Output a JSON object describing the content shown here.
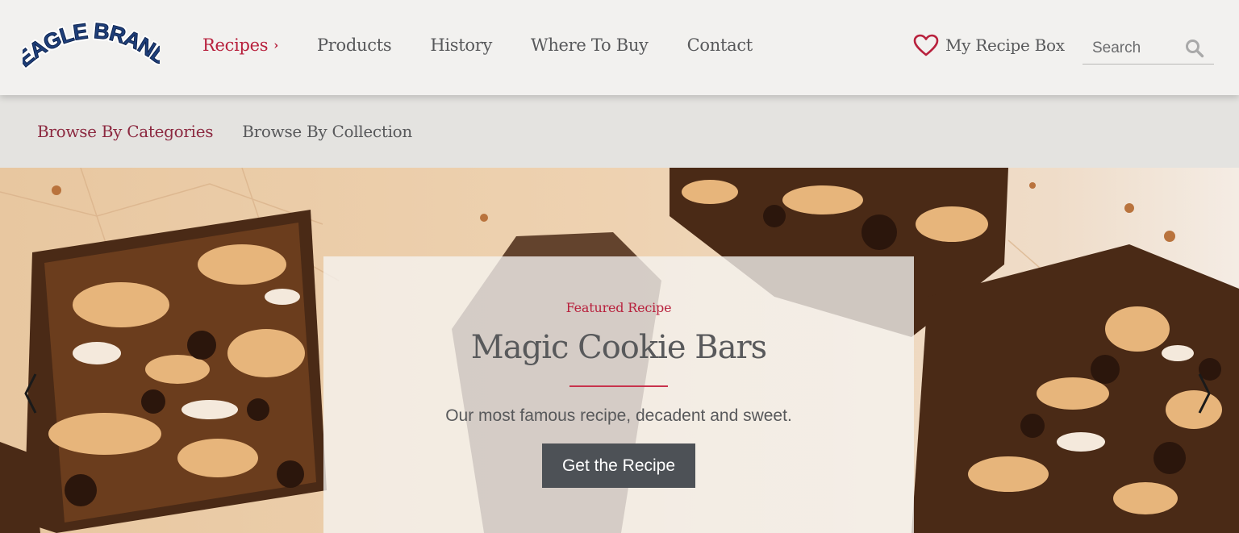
{
  "brand": {
    "logo_text": "EAGLE BRAND",
    "accent_color": "#b8213d"
  },
  "nav": {
    "items": [
      {
        "label": "Recipes",
        "active": true,
        "icon": "chevron-right-icon"
      },
      {
        "label": "Products"
      },
      {
        "label": "History"
      },
      {
        "label": "Where To Buy"
      },
      {
        "label": "Contact"
      }
    ]
  },
  "recipe_box": {
    "label": "My Recipe Box",
    "icon": "heart-icon"
  },
  "search": {
    "placeholder": "Search",
    "icon": "search-icon"
  },
  "subnav": {
    "items": [
      {
        "label": "Browse By Categories",
        "active": true
      },
      {
        "label": "Browse By Collection"
      }
    ]
  },
  "hero": {
    "eyebrow": "Featured Recipe",
    "title": "Magic Cookie Bars",
    "description": "Our most famous recipe, decadent and sweet.",
    "cta_label": "Get the Recipe",
    "prev_icon": "chevron-left-icon",
    "next_icon": "chevron-right-icon"
  }
}
